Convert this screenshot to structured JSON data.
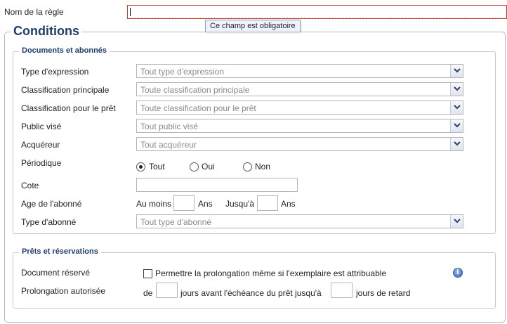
{
  "rule_name": {
    "label": "Nom de la règle",
    "value": "",
    "tooltip": "Ce champ est obligatoire"
  },
  "conditions": {
    "title": "Conditions",
    "documents_section": {
      "title": "Documents et abonnés",
      "expression_type": {
        "label": "Type d'expression",
        "selected": "Tout type d'expression"
      },
      "main_classification": {
        "label": "Classification principale",
        "selected": "Toute classification principale"
      },
      "loan_classification": {
        "label": "Classification pour le prêt",
        "selected": "Toute classification pour le prêt"
      },
      "audience": {
        "label": "Public visé",
        "selected": "Tout public visé"
      },
      "acquirer": {
        "label": "Acquéreur",
        "selected": "Tout acquéreur"
      },
      "periodical": {
        "label": "Périodique",
        "options": [
          "Tout",
          "Oui",
          "Non"
        ],
        "selected": "Tout"
      },
      "call_number": {
        "label": "Cote",
        "value": ""
      },
      "subscriber_age": {
        "label": "Age de l'abonné",
        "min_label": "Au moins",
        "min_value": "",
        "unit": "Ans",
        "max_label": "Jusqu'à",
        "max_value": ""
      },
      "subscriber_type": {
        "label": "Type d'abonné",
        "selected": "Tout type d'abonné"
      }
    },
    "loans_section": {
      "title": "Prêts et réservations",
      "reserved_document": {
        "label": "Document réservé",
        "checkbox_label": "Permettre la prolongation même si l'exemplaire est attribuable",
        "checked": false,
        "info_icon": "info-icon"
      },
      "extension_allowed": {
        "label": "Prolongation autorisée",
        "prefix": "de",
        "days_before_value": "",
        "middle_text": "jours avant l'échéance du prêt jusqu'à",
        "days_late_value": "",
        "suffix": "jours de retard"
      }
    }
  },
  "colors": {
    "accent": "#1f3e6e",
    "required_border": "#c0402c",
    "tooltip_bg": "#eef2fb"
  }
}
